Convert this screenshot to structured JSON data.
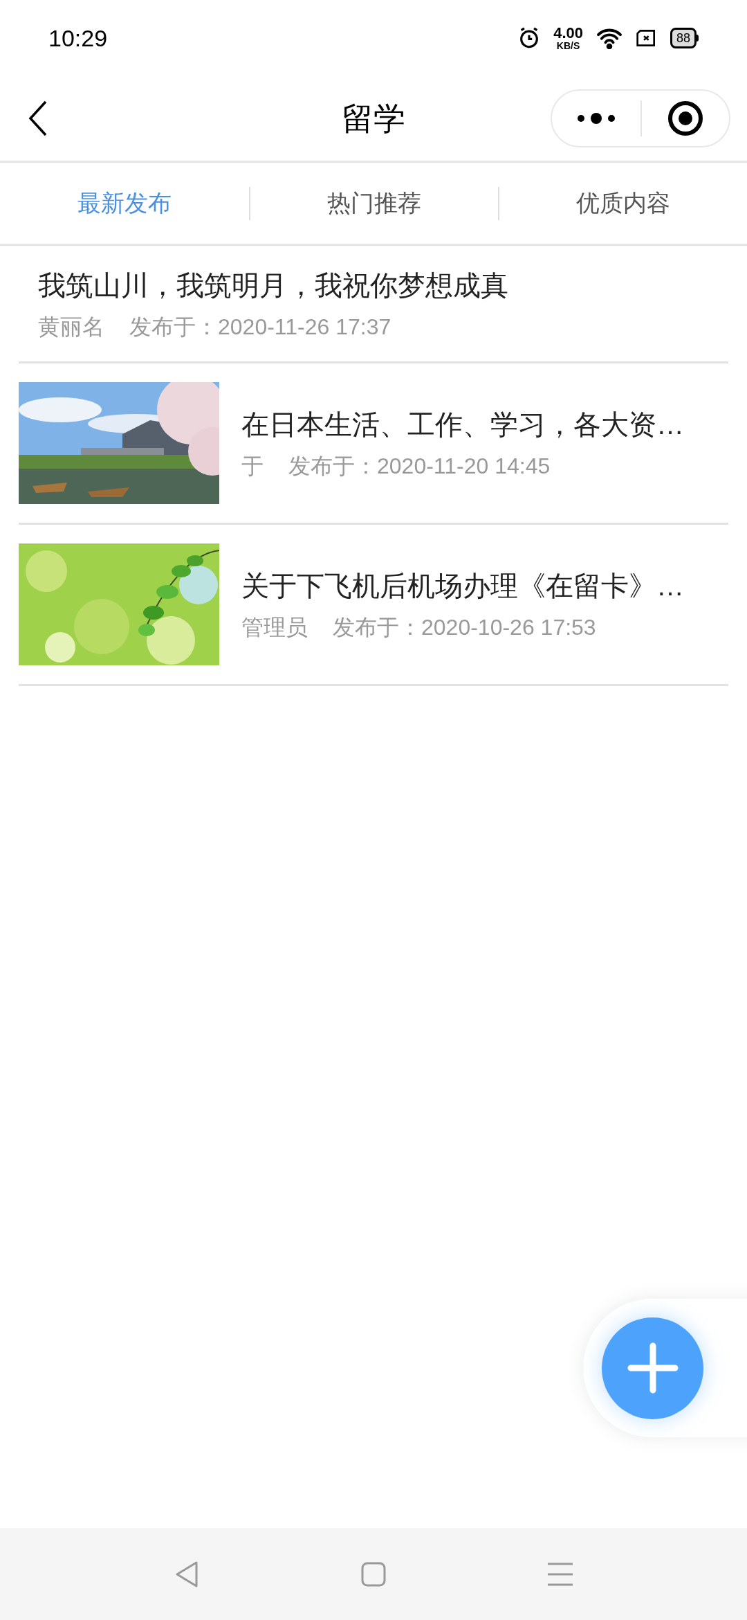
{
  "status_bar": {
    "time": "10:29",
    "speed_value": "4.00",
    "speed_unit": "KB/S",
    "battery": "88"
  },
  "nav": {
    "title": "留学"
  },
  "tabs": [
    {
      "label": "最新发布",
      "selected": true
    },
    {
      "label": "热门推荐",
      "selected": false
    },
    {
      "label": "优质内容",
      "selected": false
    }
  ],
  "articles": [
    {
      "kind": "text",
      "title": "我筑山川，我筑明月，我祝你梦想成真",
      "author": "黄丽名",
      "time": "发布于：2020-11-26 17:37"
    },
    {
      "kind": "picture",
      "title": "在日本生活、工作、学习，各大资…",
      "author": "于",
      "time": "发布于：2020-11-20 14:45"
    },
    {
      "kind": "picture",
      "title": "关于下飞机后机场办理《在留卡》…",
      "author": "管理员",
      "time": "发布于：2020-10-26 17:53"
    }
  ]
}
